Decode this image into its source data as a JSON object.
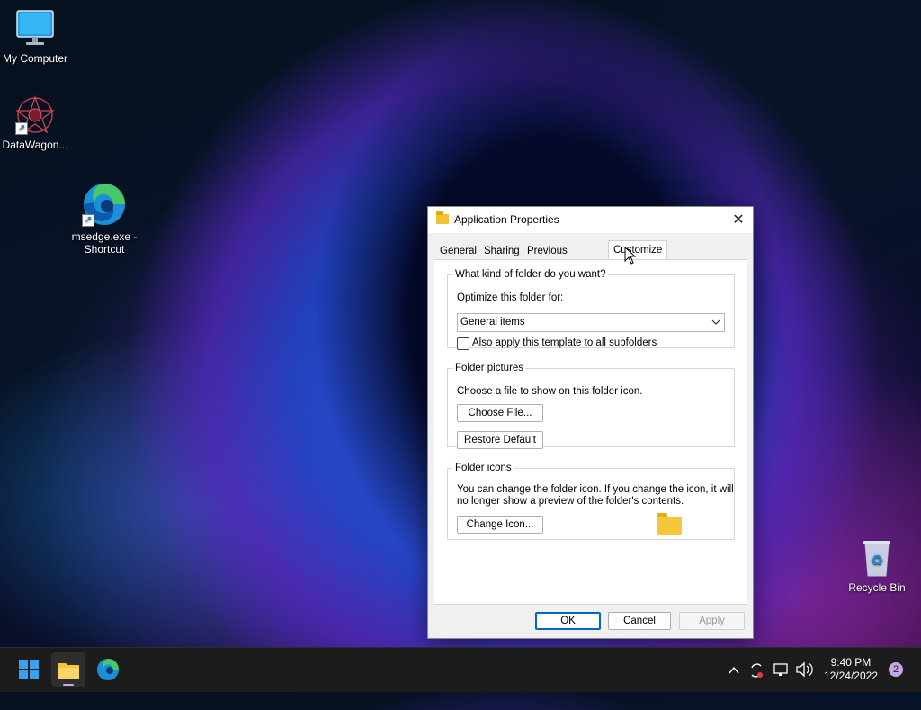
{
  "desktop": {
    "icons": [
      {
        "label": "My Computer"
      },
      {
        "label": "DataWagon..."
      },
      {
        "label": "msedge.exe - Shortcut"
      },
      {
        "label": "Recycle Bin"
      }
    ]
  },
  "dialog": {
    "title": "Application Properties",
    "close_glyph": "✕",
    "tabs": [
      "General",
      "Sharing",
      "Previous Versions",
      "Customize"
    ],
    "active_tab": "Customize",
    "section_type": {
      "legend": "What kind of folder do you want?",
      "optimize_label": "Optimize this folder for:",
      "optimize_value": "General items",
      "apply_subfolders_label": "Also apply this template to all subfolders",
      "apply_subfolders_checked": false
    },
    "section_pictures": {
      "legend": "Folder pictures",
      "description": "Choose a file to show on this folder icon.",
      "choose_file_label": "Choose File...",
      "restore_default_label": "Restore Default"
    },
    "section_icons": {
      "legend": "Folder icons",
      "description_line1": "You can change the folder icon. If you change the icon, it will",
      "description_line2": "no longer show a preview of the folder's contents.",
      "change_icon_label": "Change Icon..."
    },
    "buttons": {
      "ok": "OK",
      "cancel": "Cancel",
      "apply": "Apply"
    }
  },
  "taskbar": {
    "time": "9:40 PM",
    "date": "12/24/2022",
    "notification_count": "2",
    "tray_icons": [
      "chevron-up-icon",
      "sync-icon",
      "network-icon",
      "volume-icon"
    ]
  },
  "colors": {
    "accent": "#0067c0",
    "taskbar": "#1c1c1c",
    "folder": "#f4c63a"
  }
}
